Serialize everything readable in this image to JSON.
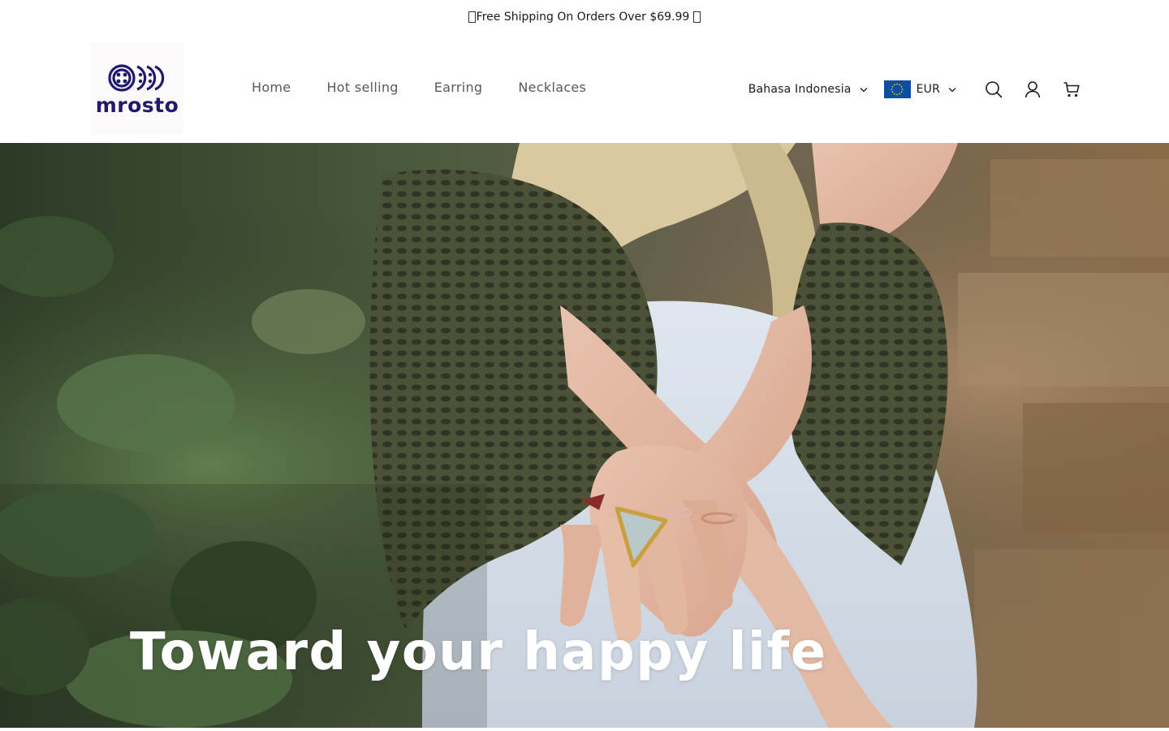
{
  "announcement": {
    "text": "Free Shipping On Orders Over $69.99"
  },
  "brand": {
    "logo_text": "mrosto",
    "logo_color": "#1f1a6e"
  },
  "nav": {
    "items": [
      {
        "label": "Home"
      },
      {
        "label": "Hot selling"
      },
      {
        "label": "Earring"
      },
      {
        "label": "Necklaces"
      }
    ]
  },
  "localization": {
    "language": "Bahasa Indonesia",
    "currency": "EUR",
    "flag_color": "#0b4ea2"
  },
  "icons": {
    "search": "search-icon",
    "account": "account-icon",
    "cart": "cart-icon"
  },
  "hero": {
    "heading": "Toward your happy life"
  }
}
